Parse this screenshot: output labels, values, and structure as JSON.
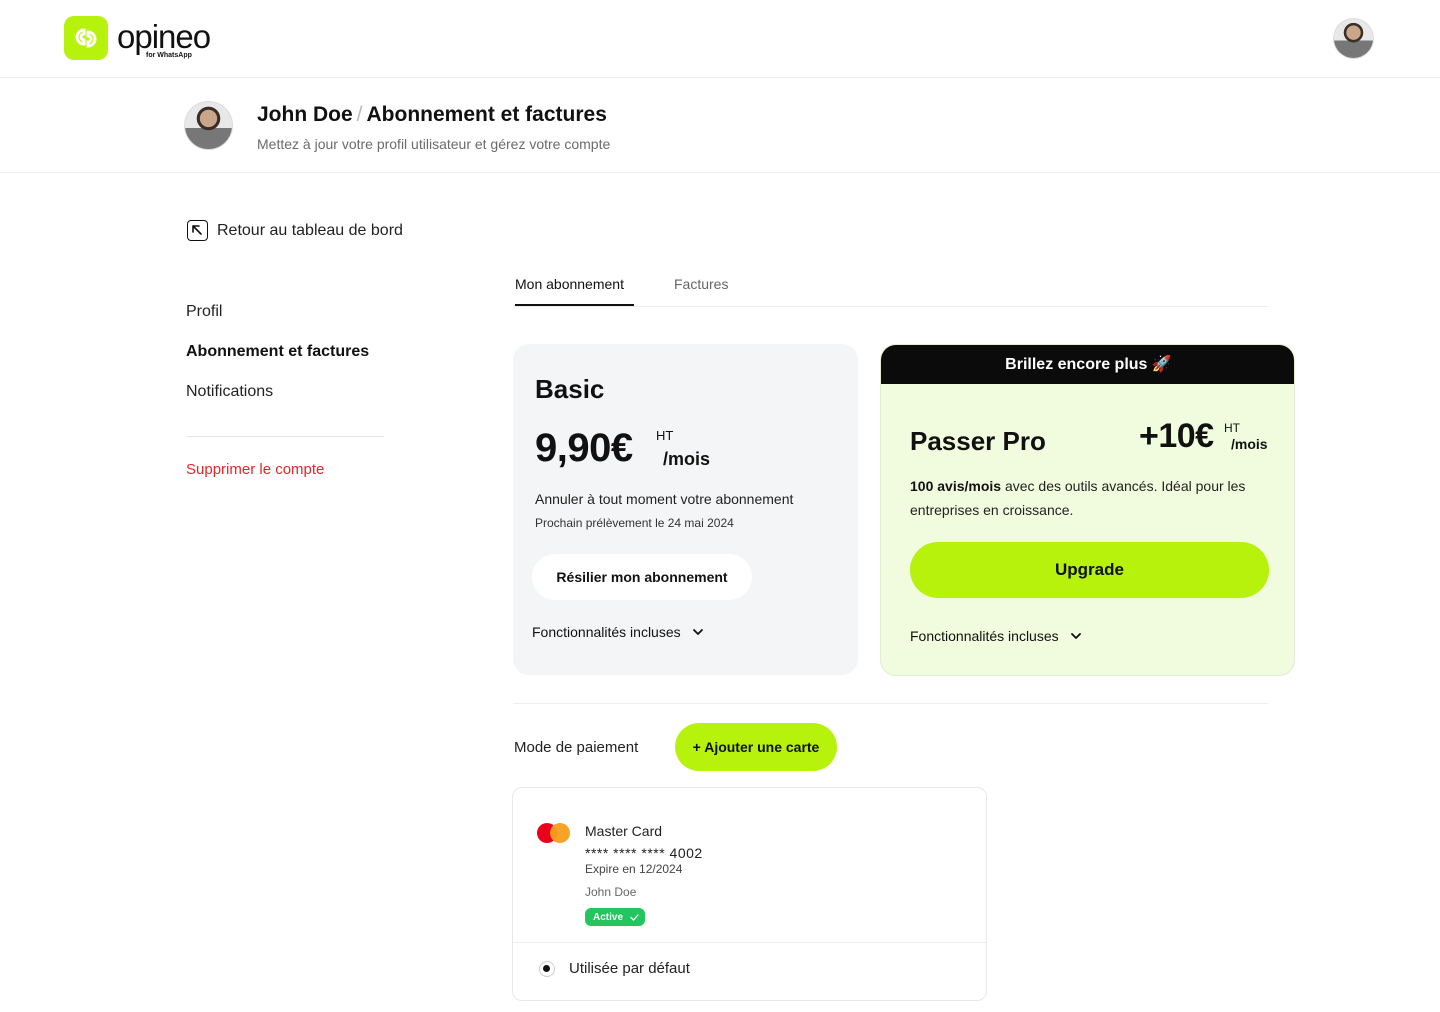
{
  "brand": {
    "name": "opineo",
    "tagline": "for WhatsApp",
    "accent": "#b6f20c"
  },
  "header": {
    "user_name": "John Doe",
    "separator": "/",
    "section_title": "Abonnement et factures",
    "subtitle": "Mettez à jour votre profil utilisateur et gérez votre compte"
  },
  "back_link": {
    "label": "Retour au tableau de bord",
    "icon": "arrow-up-left-icon"
  },
  "sidebar": {
    "items": [
      {
        "label": "Profil",
        "active": false
      },
      {
        "label": "Abonnement et factures",
        "active": true
      },
      {
        "label": "Notifications",
        "active": false
      }
    ],
    "danger_label": "Supprimer le compte"
  },
  "tabs": [
    {
      "label": "Mon abonnement",
      "active": true
    },
    {
      "label": "Factures",
      "active": false
    }
  ],
  "plan_current": {
    "name": "Basic",
    "price": "9,90€",
    "tax_label": "HT",
    "period": "/mois",
    "cancel_text": "Annuler à tout moment votre abonnement",
    "next_charge": "Prochain prélèvement le 24 mai 2024",
    "cancel_button": "Résilier mon abonnement",
    "features_label": "Fonctionnalités incluses"
  },
  "plan_upgrade": {
    "banner": "Brillez encore plus 🚀",
    "name": "Passer Pro",
    "price": "+10€",
    "tax_label": "HT",
    "period": "/mois",
    "desc_bold": "100 avis/mois",
    "desc_rest": " avec des outils avancés. Idéal pour les entreprises en croissance.",
    "button": "Upgrade",
    "features_label": "Fonctionnalités incluses"
  },
  "payment": {
    "label": "Mode de paiement",
    "add_button": "+ Ajouter une carte",
    "card": {
      "brand": "Master Card",
      "number": "**** **** **** 4002",
      "expiry": "Expire en 12/2024",
      "holder": "John Doe",
      "status": "Active",
      "status_color": "#22c55e",
      "default_label": "Utilisée par défaut"
    }
  }
}
